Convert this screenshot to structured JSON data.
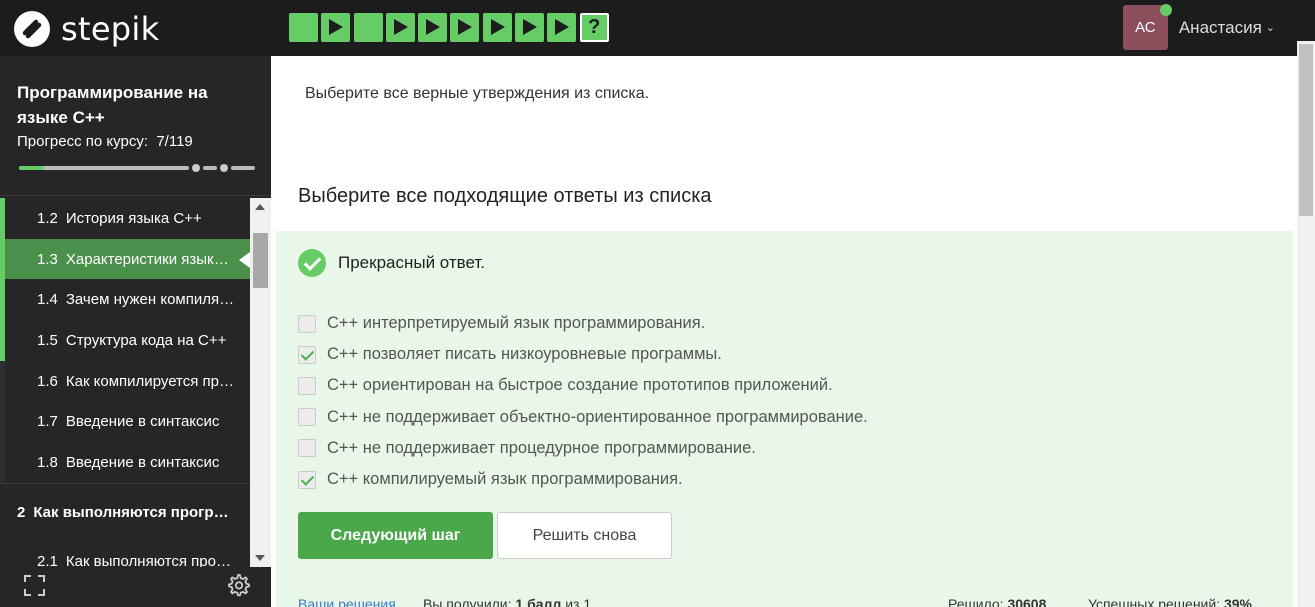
{
  "brand": {
    "name": "stepik"
  },
  "steps": [
    {
      "kind": "plain"
    },
    {
      "kind": "play"
    },
    {
      "kind": "plain"
    },
    {
      "kind": "play"
    },
    {
      "kind": "play"
    },
    {
      "kind": "play"
    },
    {
      "kind": "play"
    },
    {
      "kind": "play"
    },
    {
      "kind": "play"
    },
    {
      "kind": "quiz",
      "label": "?"
    }
  ],
  "user": {
    "initials": "АС",
    "name": "Анастасия",
    "online": true
  },
  "sidebar": {
    "course_title": "Программирование на языке С++",
    "progress_label": "Прогресс по курсу:",
    "progress_value": "7/119",
    "progress_fraction": 0.059,
    "lessons": [
      {
        "num": "1.2",
        "title": "История языка С++",
        "active": false,
        "done": true
      },
      {
        "num": "1.3",
        "title": "Характеристики языка С++",
        "active": true,
        "done": true
      },
      {
        "num": "1.4",
        "title": "Зачем нужен компилятор",
        "active": false,
        "done": true
      },
      {
        "num": "1.5",
        "title": "Структура кода на С++",
        "active": false,
        "done": true
      },
      {
        "num": "1.6",
        "title": "Как компилируется программа",
        "active": false,
        "done": false
      },
      {
        "num": "1.7",
        "title": "Введение в синтаксис",
        "active": false,
        "done": false
      },
      {
        "num": "1.8",
        "title": "Введение в синтаксис",
        "active": false,
        "done": false
      }
    ],
    "module": {
      "num": "2",
      "title": "Как выполняются программы"
    },
    "next_lesson": {
      "num": "2.1",
      "title": "Как выполняются программы"
    },
    "icons": {
      "fullscreen": "fullscreen-icon",
      "settings": "gear-icon"
    }
  },
  "main": {
    "question": "Выберите все верные утверждения из списка.",
    "answers_heading": "Выберите все подходящие ответы из списка",
    "result_text": "Прекрасный ответ.",
    "options": [
      {
        "text": "С++ интерпретируемый язык программирования.",
        "checked": false
      },
      {
        "text": "С++ позволяет писать низкоуровневые программы.",
        "checked": true
      },
      {
        "text": "С++ ориентирован на быстрое создание прототипов приложений.",
        "checked": false
      },
      {
        "text": "С++ не поддерживает объектно-ориентированное программирование.",
        "checked": false
      },
      {
        "text": "С++ не поддерживает процедурное программирование.",
        "checked": false
      },
      {
        "text": "С++ компилируемый язык программирования.",
        "checked": true
      }
    ],
    "next_button": "Следующий шаг",
    "retry_button": "Решить снова",
    "footer": {
      "solutions_link": "Ваши решения",
      "score_prefix": "Вы получили:",
      "score_value": "1 балл",
      "score_suffix": "из 1",
      "solved_label": "Решило:",
      "solved_value": "30608",
      "success_label": "Успешных решений:",
      "success_value": "39%"
    }
  },
  "colors": {
    "accent": "#66cc66",
    "topbar": "#1c1c1c",
    "sidebar": "#262626",
    "success_bg": "#e8f7e8"
  }
}
